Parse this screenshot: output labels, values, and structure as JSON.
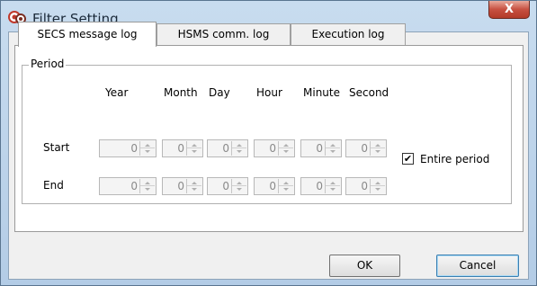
{
  "window": {
    "title": "Filter Setting",
    "close_label": "X"
  },
  "tabs": [
    {
      "label": "SECS message log",
      "selected": true
    },
    {
      "label": "HSMS comm. log"
    },
    {
      "label": "Execution log"
    }
  ],
  "period": {
    "legend": "Period",
    "headers": [
      "Year",
      "Month",
      "Day",
      "Hour",
      "Minute",
      "Second"
    ],
    "start": {
      "label": "Start",
      "values": [
        "0",
        "0",
        "0",
        "0",
        "0",
        "0"
      ]
    },
    "end": {
      "label": "End",
      "values": [
        "0",
        "0",
        "0",
        "0",
        "0",
        "0"
      ]
    },
    "entire_period": {
      "label": "Entire period",
      "checked": true,
      "mark": "✔"
    }
  },
  "buttons": {
    "ok": "OK",
    "cancel": "Cancel"
  }
}
